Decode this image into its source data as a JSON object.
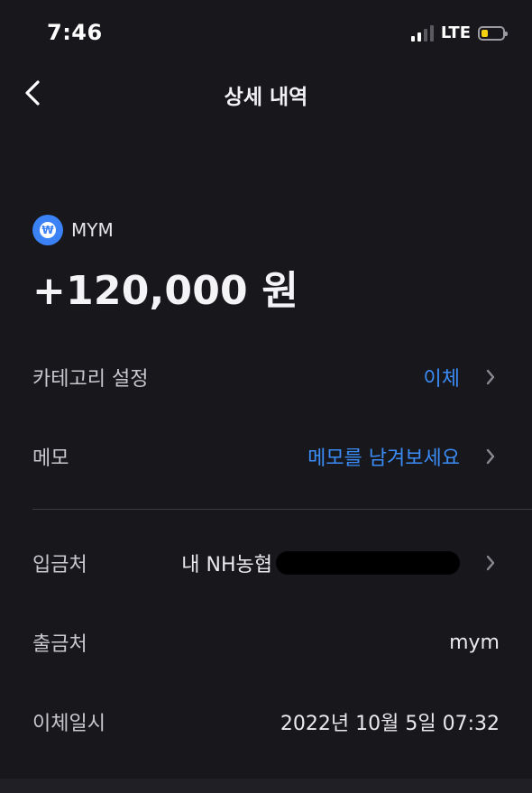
{
  "status_bar": {
    "time": "7:46",
    "network": "LTE",
    "battery_level": 0.3,
    "signal_bars_active": 2,
    "signal_bars_total": 4
  },
  "header": {
    "title": "상세 내역",
    "back_icon": "chevron-left-icon"
  },
  "account": {
    "icon": "won-icon",
    "icon_symbol": "₩",
    "name": "MYM"
  },
  "amount": "+120,000 원",
  "rows": {
    "category": {
      "label": "카테고리 설정",
      "value": "이체"
    },
    "memo": {
      "label": "메모",
      "value": "메모를 남겨보세요"
    },
    "deposit_to": {
      "label": "입금처",
      "value": "내 NH농협"
    },
    "withdraw_from": {
      "label": "출금처",
      "value": "mym"
    },
    "transfer_time": {
      "label": "이체일시",
      "value": "2022년 10월 5일 07:32"
    }
  },
  "colors": {
    "background": "#17171c",
    "accent": "#3b8cf7",
    "badge": "#3b82f6",
    "battery": "#f5d10e"
  }
}
